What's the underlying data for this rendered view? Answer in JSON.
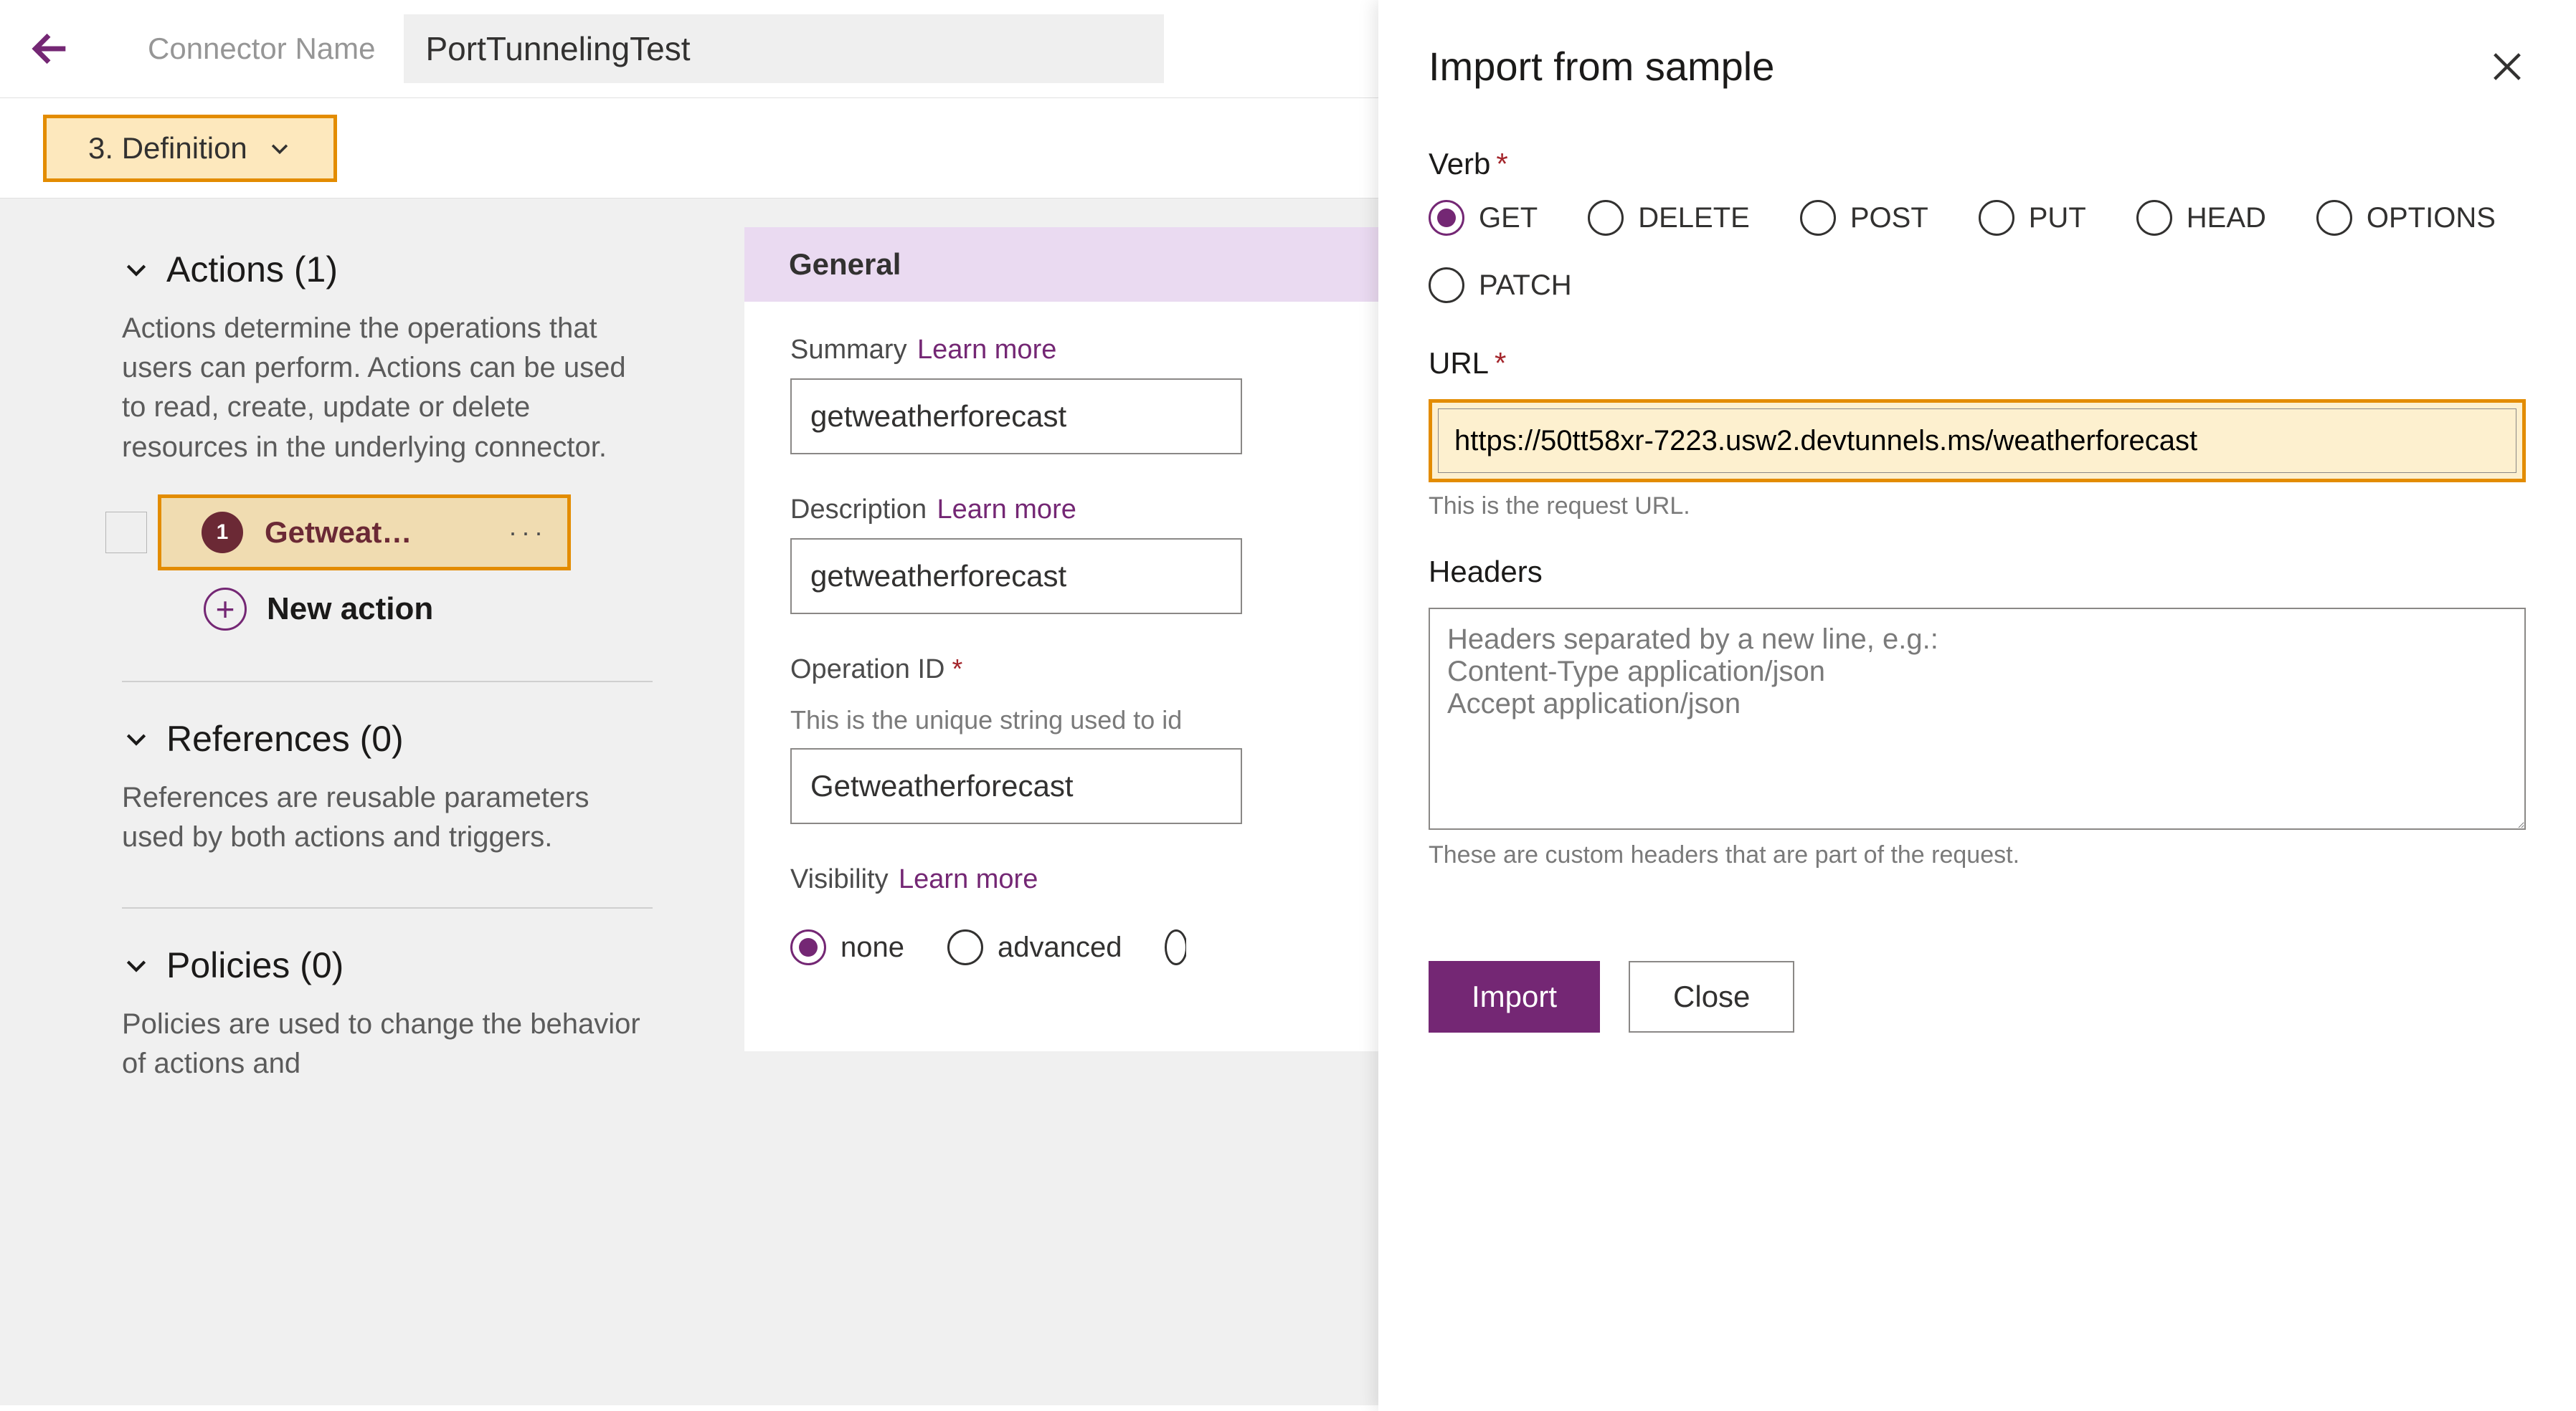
{
  "topbar": {
    "connector_name_label": "Connector Name",
    "connector_name_value": "PortTunnelingTest"
  },
  "step": {
    "label": "3. Definition"
  },
  "left": {
    "actions": {
      "title": "Actions (1)",
      "desc": "Actions determine the operations that users can perform. Actions can be used to read, create, update or delete resources in the underlying connector.",
      "items": [
        {
          "badge": "1",
          "label": "Getweat…",
          "more": "···"
        }
      ],
      "new_label": "New action"
    },
    "references": {
      "title": "References (0)",
      "desc": "References are reusable parameters used by both actions and triggers."
    },
    "policies": {
      "title": "Policies (0)",
      "desc": "Policies are used to change the behavior of actions and"
    }
  },
  "general": {
    "section_title": "General",
    "summary_label": "Summary",
    "summary_learn": "Learn more",
    "summary_value": "getweatherforecast",
    "description_label": "Description",
    "description_learn": "Learn more",
    "description_value": "getweatherforecast",
    "operation_id_label": "Operation ID",
    "operation_id_help": "This is the unique string used to id",
    "operation_id_value": "Getweatherforecast",
    "visibility_label": "Visibility",
    "visibility_learn": "Learn more",
    "visibility_options": [
      "none",
      "advanced"
    ],
    "visibility_selected": "none"
  },
  "panel": {
    "title": "Import from sample",
    "verb_label": "Verb",
    "verbs": [
      "GET",
      "DELETE",
      "POST",
      "PUT",
      "HEAD",
      "OPTIONS",
      "PATCH"
    ],
    "verb_selected": "GET",
    "url_label": "URL",
    "url_value": "https://50tt58xr-7223.usw2.devtunnels.ms/weatherforecast",
    "url_help": "This is the request URL.",
    "headers_label": "Headers",
    "headers_placeholder": "Headers separated by a new line, e.g.:\nContent-Type application/json\nAccept application/json",
    "headers_help": "These are custom headers that are part of the request.",
    "import_btn": "Import",
    "close_btn": "Close"
  }
}
